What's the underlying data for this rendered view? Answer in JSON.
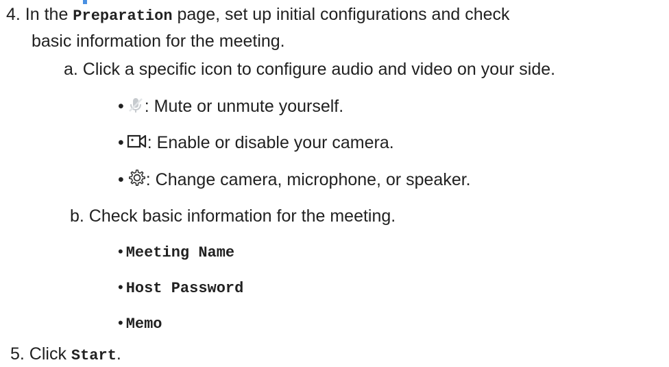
{
  "step4": {
    "prefix": "4. In the ",
    "page_name": "Preparation",
    "suffix": " page, set up initial configurations and check",
    "continuation": "basic information for the meeting."
  },
  "step4a": {
    "text": "a. Click a specific icon to configure audio and video on your side.",
    "bullets": [
      {
        "icon": "microphone-muted-icon",
        "text": ": Mute or unmute yourself."
      },
      {
        "icon": "video-camera-icon",
        "text": ": Enable or disable your camera."
      },
      {
        "icon": "gear-icon",
        "text": ": Change camera, microphone, or speaker."
      }
    ]
  },
  "step4b": {
    "text": "b. Check basic information for the meeting.",
    "items": [
      "Meeting Name",
      "Host Password",
      "Memo"
    ]
  },
  "step5": {
    "prefix": "5. Click ",
    "action": "Start",
    "suffix": "."
  },
  "bullet_char": "•",
  "colors": {
    "text": "#212121",
    "accent": "#4a90e2",
    "icon_gray": "#b8bcc2"
  }
}
